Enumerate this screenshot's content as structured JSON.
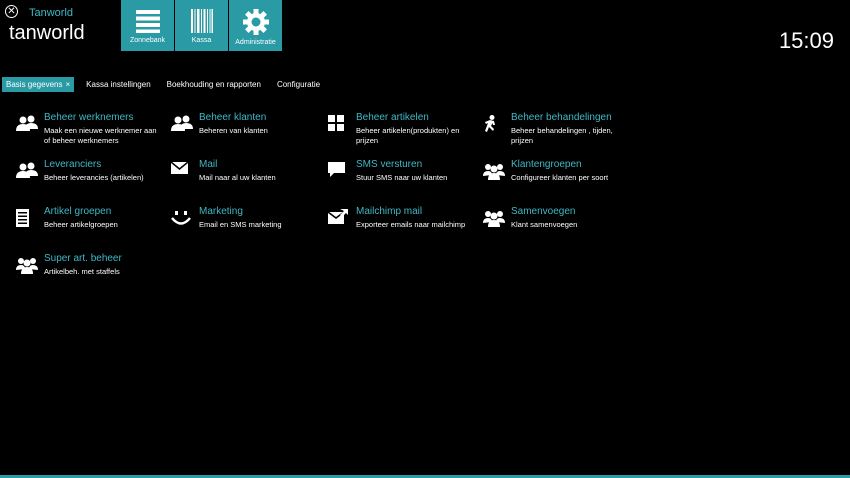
{
  "app": {
    "small_title": "Tanworld",
    "big_title": "tanworld",
    "clock": "15:09",
    "accent": "#2a9aa4",
    "text_accent": "#3fb8c6"
  },
  "close_symbol": "✕",
  "modules": [
    {
      "label": "Zonnebank",
      "icon": "hamburger-icon"
    },
    {
      "label": "Kassa",
      "icon": "barcode-icon"
    },
    {
      "label": "Administratie",
      "icon": "gear-icon"
    }
  ],
  "tabs": [
    {
      "label": "Basis gegevens",
      "active": true,
      "close": "×"
    },
    {
      "label": "Kassa instellingen"
    },
    {
      "label": "Boekhouding en rapporten"
    },
    {
      "label": "Configuratie"
    }
  ],
  "items": [
    {
      "title": "Beheer werknemers",
      "desc": "Maak een nieuwe werknemer aan of beheer werknemers",
      "icon": "users-icon"
    },
    {
      "title": "Beheer klanten",
      "desc": "Beheren van klanten",
      "icon": "users-icon"
    },
    {
      "title": "Beheer artikelen",
      "desc": "Beheer artikelen(produkten) en prijzen",
      "icon": "grid-icon"
    },
    {
      "title": "Beheer behandelingen",
      "desc": "Beheer behandelingen , tijden, prijzen",
      "icon": "person-icon"
    },
    {
      "title": "Leveranciers",
      "desc": "Beheer leverancies (artikelen)",
      "icon": "users-icon"
    },
    {
      "title": "Mail",
      "desc": "Mail naar al uw klanten",
      "icon": "mail-icon"
    },
    {
      "title": "SMS versturen",
      "desc": "Stuur SMS naar uw klanten",
      "icon": "chat-icon"
    },
    {
      "title": "Klantengroepen",
      "desc": "Configureer klanten per soort",
      "icon": "group-icon"
    },
    {
      "title": "Artikel groepen",
      "desc": "Beheer artikelgroepen",
      "icon": "list-icon"
    },
    {
      "title": "Marketing",
      "desc": "Email en SMS marketing",
      "icon": "smile-icon"
    },
    {
      "title": "Mailchimp mail",
      "desc": "Exporteer emails naar mailchimp",
      "icon": "mail-export-icon"
    },
    {
      "title": "Samenvoegen",
      "desc": "Klant samenvoegen",
      "icon": "group-icon"
    },
    {
      "title": "Super art. beheer",
      "desc": "Artikelbeh. met staffels",
      "icon": "group-icon"
    }
  ]
}
